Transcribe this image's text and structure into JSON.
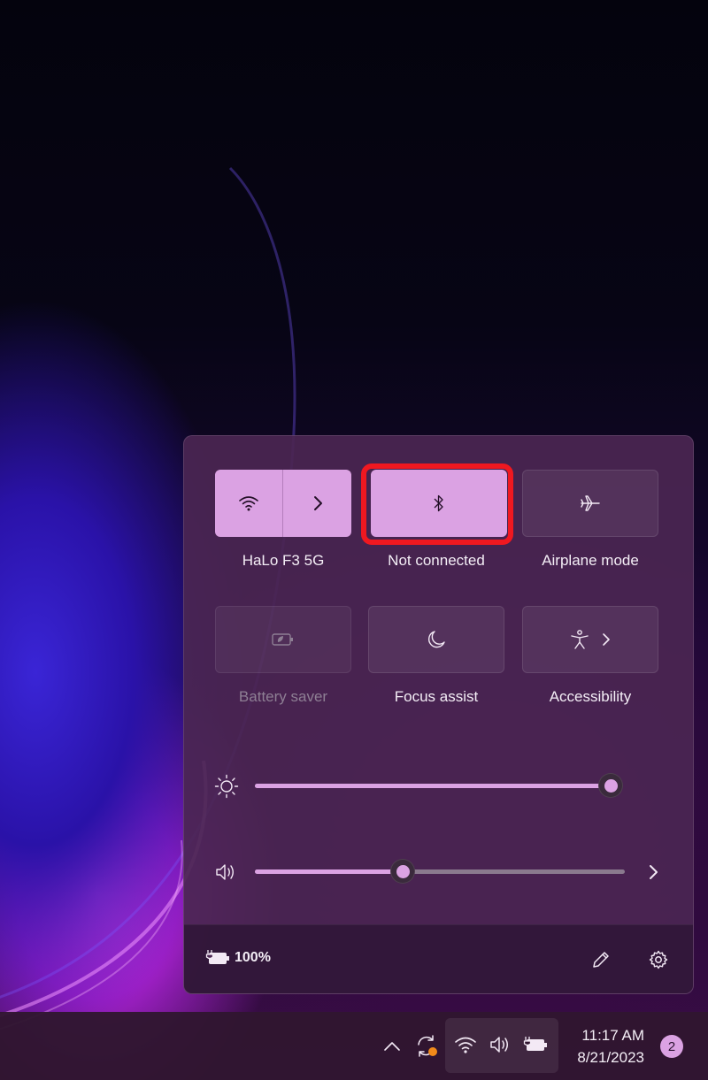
{
  "quick_settings": {
    "tiles": [
      {
        "label": "HaLo F3 5G",
        "icon": "wifi-icon",
        "state": "on",
        "secondary_icon": "chevron-right-icon"
      },
      {
        "label": "Not connected",
        "icon": "bluetooth-icon",
        "state": "on"
      },
      {
        "label": "Airplane mode",
        "icon": "airplane-icon",
        "state": "off"
      },
      {
        "label": "Battery saver",
        "icon": "battery-saver-icon",
        "state": "disabled"
      },
      {
        "label": "Focus assist",
        "icon": "moon-icon",
        "state": "off"
      },
      {
        "label": "Accessibility",
        "icon": "accessibility-icon",
        "state": "off",
        "secondary_icon": "chevron-right-icon"
      }
    ],
    "brightness": {
      "icon": "brightness-icon",
      "level": 1.0
    },
    "volume": {
      "icon": "speaker-icon",
      "level": 0.4,
      "more_icon": "chevron-right-icon"
    },
    "footer": {
      "battery_icon": "battery-charging-icon",
      "battery_percent": "100%",
      "edit_icon": "pencil-icon",
      "settings_icon": "gear-icon"
    }
  },
  "taskbar": {
    "tray": {
      "overflow_icon": "chevron-up-icon",
      "sync_icon": "sync-icon",
      "wifi_icon": "wifi-icon",
      "volume_icon": "speaker-icon",
      "battery_icon": "battery-charging-icon"
    },
    "time": "11:17 AM",
    "date": "8/21/2023",
    "notification_count": "2"
  },
  "colors": {
    "accent": "#dba2e3",
    "highlight_frame": "#f01820",
    "panel": "#4b2652",
    "taskbar": "#301630"
  }
}
